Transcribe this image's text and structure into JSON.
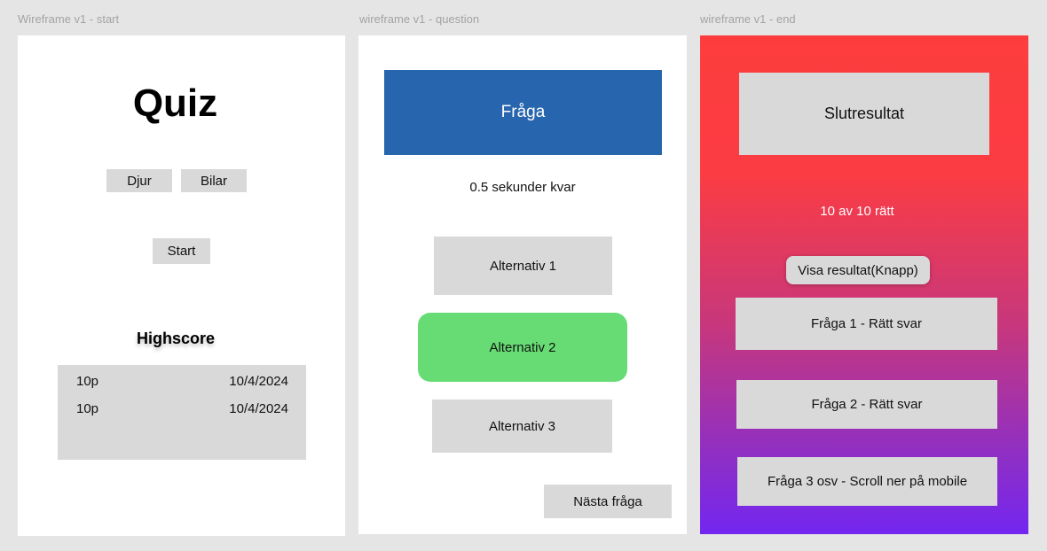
{
  "frames": {
    "start": {
      "label": "Wireframe v1 - start",
      "title": "Quiz",
      "categories": [
        "Djur",
        "Bilar"
      ],
      "start_label": "Start",
      "highscore_title": "Highscore",
      "highscores": [
        {
          "points": "10p",
          "date": "10/4/2024"
        },
        {
          "points": "10p",
          "date": "10/4/2024"
        }
      ]
    },
    "question": {
      "label": "wireframe v1 - question",
      "question": "Fråga",
      "timer": "0.5 sekunder kvar",
      "alternatives": [
        "Alternativ 1",
        "Alternativ 2",
        "Alternativ 3"
      ],
      "next_label": "Nästa fråga"
    },
    "end": {
      "label": "wireframe v1 - end",
      "result_title": "Slutresultat",
      "score": "10 av 10 rätt",
      "show_results_label": "Visa resultat(Knapp)",
      "answers": [
        "Fråga 1 - Rätt svar",
        "Fråga 2 - Rätt svar",
        "Fråga 3 osv - Scroll ner på mobile"
      ]
    }
  },
  "colors": {
    "canvas": "#e5e5e5",
    "frame_bg": "#ffffff",
    "box_grey": "#d9d9d9",
    "question_blue": "#2765ae",
    "selected_green": "#67dc74",
    "gradient_top": "#fd3d3d",
    "gradient_bottom": "#7426f0"
  }
}
